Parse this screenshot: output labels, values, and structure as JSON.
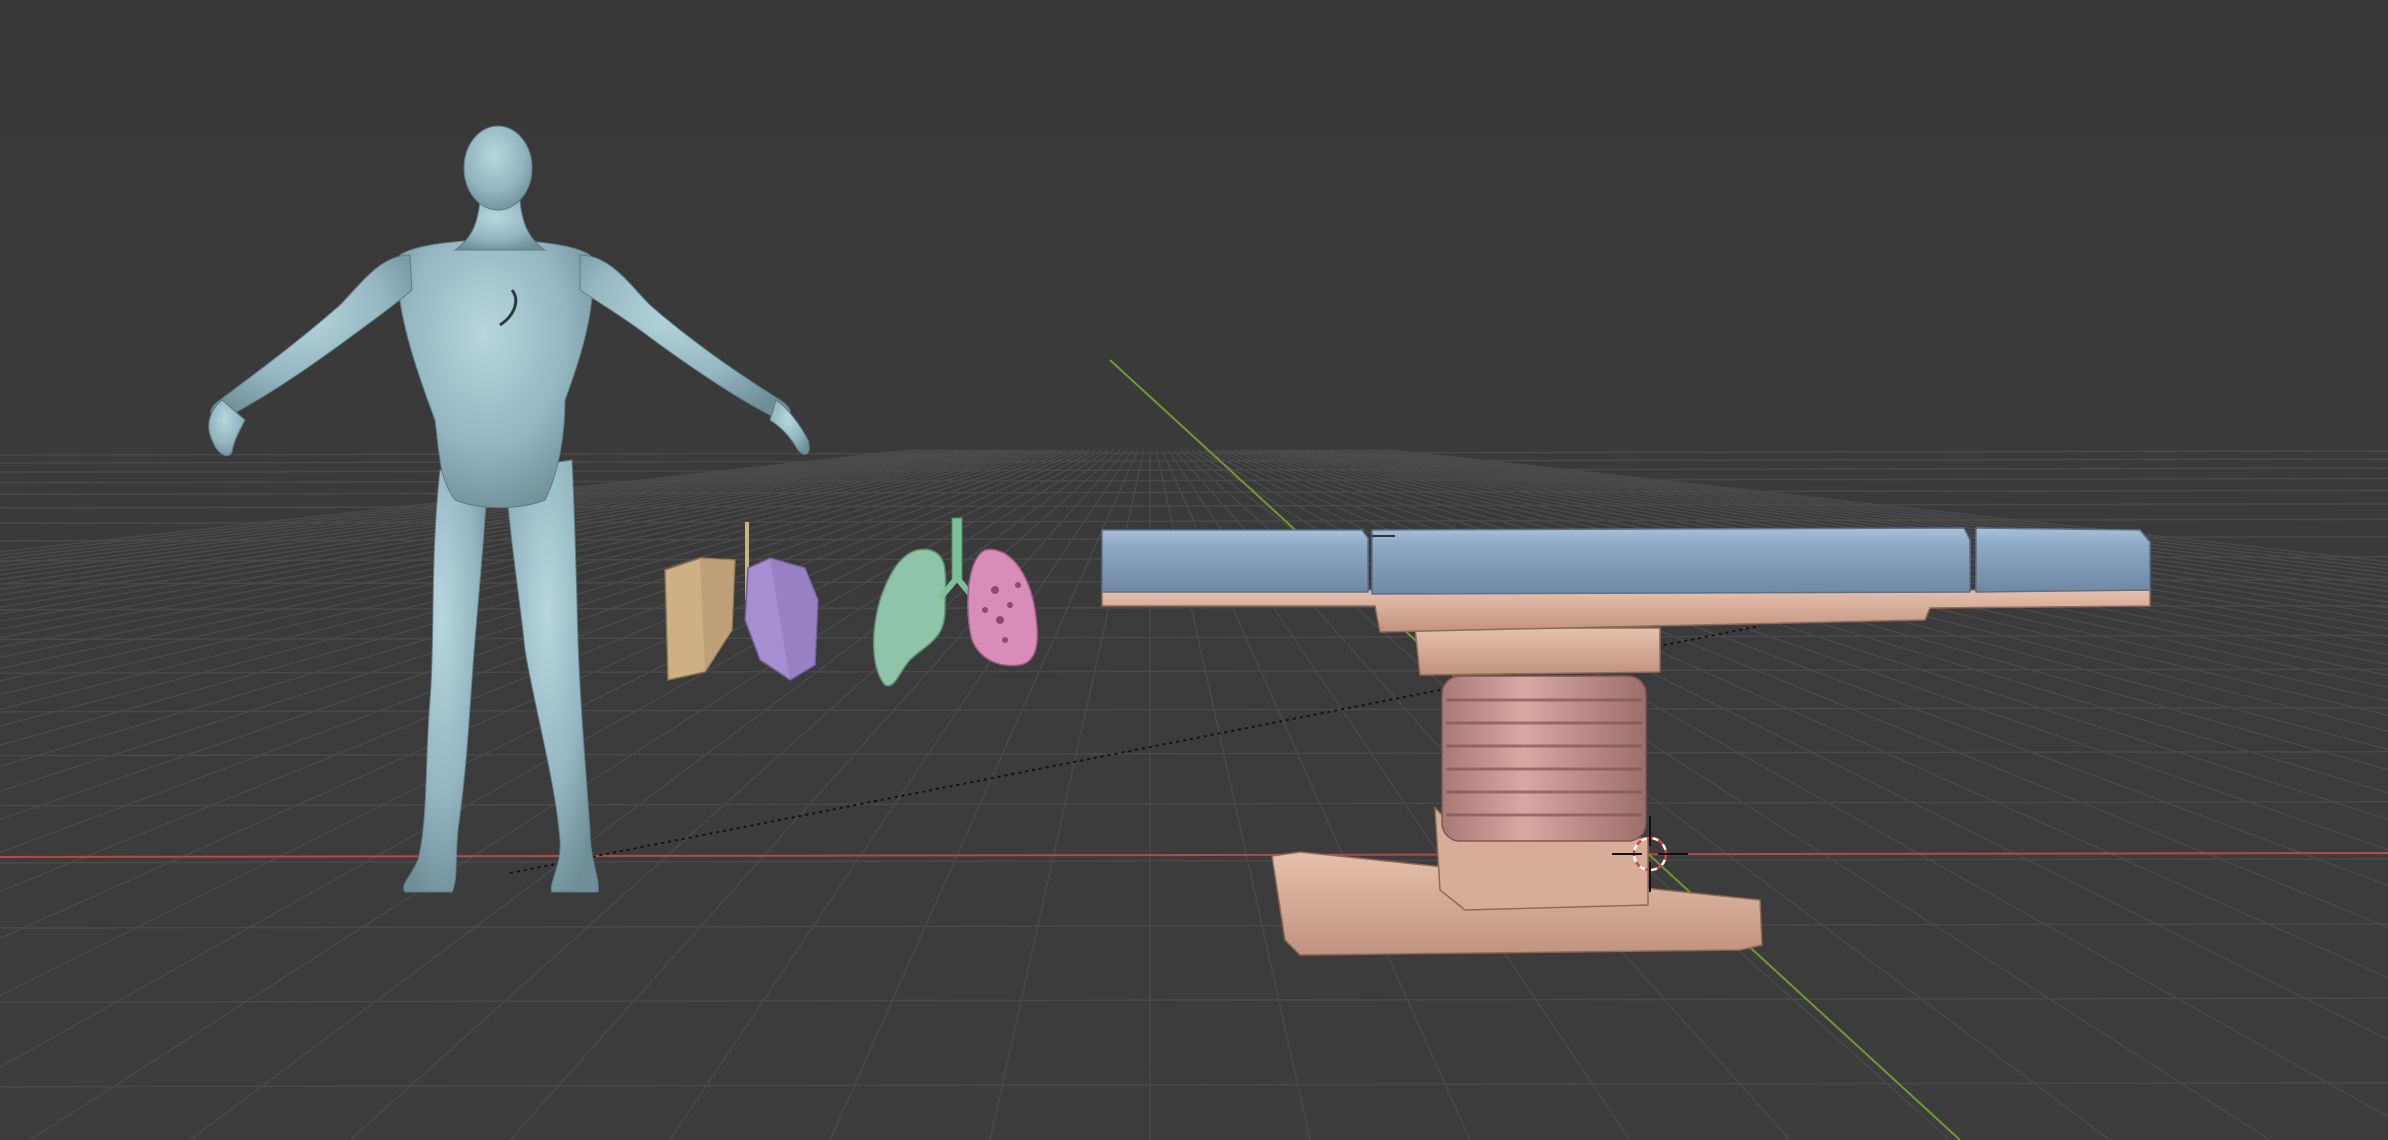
{
  "viewport": {
    "background": "#3a3a3a",
    "grid_color": "#4a4a4a",
    "x_axis_color": "#c44a4a",
    "y_axis_color": "#7aa83a"
  },
  "scene": {
    "objects": [
      {
        "id": "human-figure",
        "color": "#9cc0ca"
      },
      {
        "id": "organ-box-tan",
        "color": "#cfb084"
      },
      {
        "id": "organ-box-purple",
        "color": "#a58fd0"
      },
      {
        "id": "lung-left",
        "color": "#8fc4a8"
      },
      {
        "id": "trachea",
        "color": "#7fbf9a"
      },
      {
        "id": "lung-right",
        "color": "#d88cb8"
      },
      {
        "id": "operating-table",
        "mattress_color": "#8fa8c4",
        "frame_color": "#d8ab96"
      }
    ],
    "cursor": "3d-cursor-icon"
  }
}
